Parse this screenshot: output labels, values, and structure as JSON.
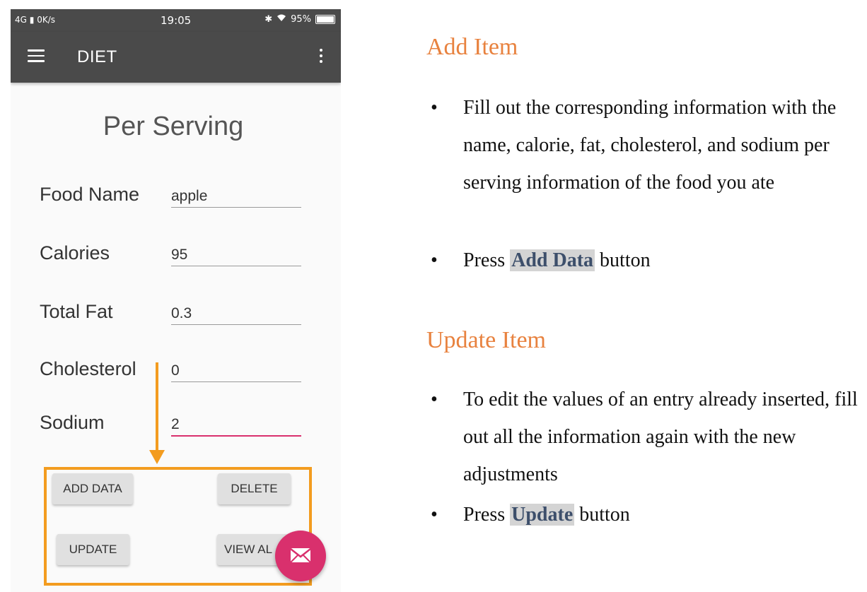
{
  "status_bar": {
    "network": "4G",
    "speed": "0K/s",
    "time": "19:05",
    "battery": "95%"
  },
  "app_bar": {
    "title": "DIET"
  },
  "form": {
    "heading": "Per Serving",
    "fields": [
      {
        "label": "Food Name",
        "value": "apple"
      },
      {
        "label": "Calories",
        "value": "95"
      },
      {
        "label": "Total Fat",
        "value": "0.3"
      },
      {
        "label": "Cholesterol",
        "value": "0"
      },
      {
        "label": "Sodium",
        "value": "2"
      }
    ]
  },
  "buttons": {
    "add_data": "ADD DATA",
    "delete": "DELETE",
    "update": "UPDATE",
    "view_all": "VIEW AL"
  },
  "colors": {
    "accent": "#d9306d",
    "highlight_box": "#f39c1f",
    "heading_orange": "#e8823f",
    "app_bar": "#4a4a4a"
  },
  "doc": {
    "add_item": {
      "title": "Add Item",
      "bullet1": "Fill out the corresponding information with the name, calorie, fat, cholesterol, and sodium per serving information of the food you ate",
      "bullet2_before": "Press",
      "bullet2_highlight": "Add Data",
      "bullet2_after": "button"
    },
    "update_item": {
      "title": "Update Item",
      "bullet1": "To edit the values of an entry already inserted, fill out all the information again with the new adjustments",
      "bullet2_before": "Press",
      "bullet2_highlight": "Update",
      "bullet2_after": "button"
    }
  }
}
